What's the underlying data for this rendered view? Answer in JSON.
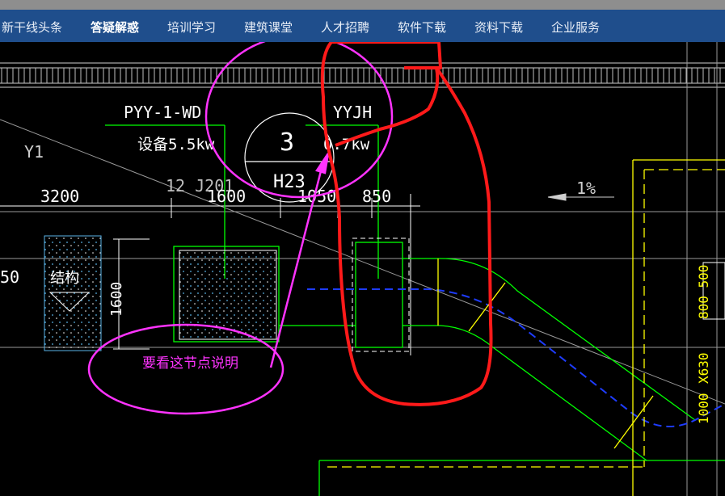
{
  "nav": {
    "items": [
      {
        "label": "新干线头条",
        "active": false
      },
      {
        "label": "答疑解惑",
        "active": true
      },
      {
        "label": "培训学习",
        "active": false
      },
      {
        "label": "建筑课堂",
        "active": false
      },
      {
        "label": "人才招聘",
        "active": false
      },
      {
        "label": "软件下载",
        "active": false
      },
      {
        "label": "资料下载",
        "active": false
      },
      {
        "label": "企业服务",
        "active": false
      }
    ]
  },
  "drawing": {
    "equipment_code": "PYY-1-WD",
    "equipment_power": "设备5.5kw",
    "yyjh_code": "YYJH",
    "yyjh_power": "0.7kw",
    "circle_number": "3",
    "circle_label": "H23",
    "y1_label": "Y1",
    "atlas_ref": "12 J201",
    "dim_3200": "3200",
    "dim_1600": "1600",
    "dim_1050": "1050",
    "dim_850": "850",
    "slope": "1%",
    "left_partial": "50",
    "structure_label": "结构",
    "vertical_dim": "1600",
    "right_label_1": "800 500",
    "right_label_2": "X630",
    "right_label_3": "1000",
    "annotation": "要看这节点说明"
  },
  "colors": {
    "nav_bg": "#1f4e8c",
    "cad_green": "#00ff00",
    "cad_white": "#ffffff",
    "cad_yellow": "#ffff00",
    "markup_red": "#ff1a1a",
    "markup_magenta": "#ff33ff",
    "hatch_cyan": "#5ab4e8"
  }
}
